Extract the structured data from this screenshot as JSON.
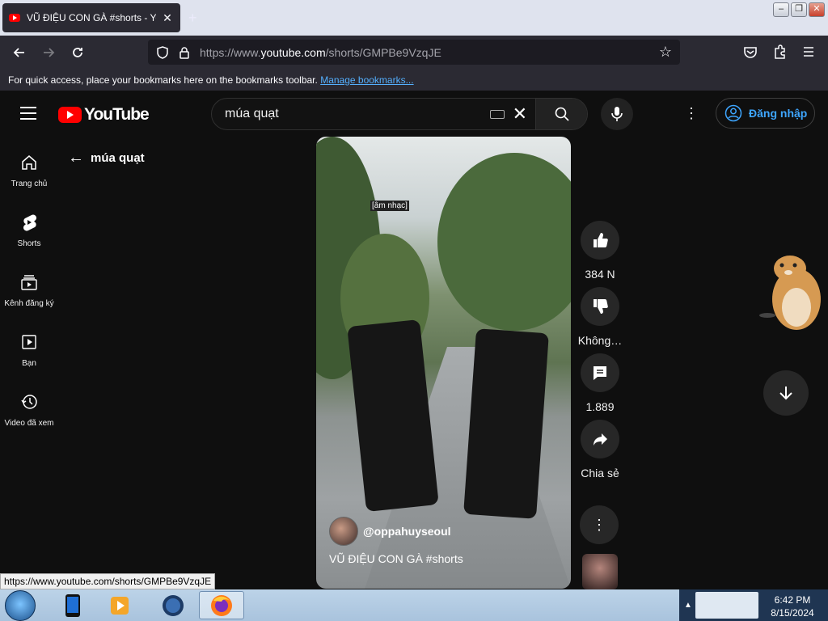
{
  "browser": {
    "tab_title": "VŨ ĐIỆU CON GÀ #shorts - YouTube",
    "tab_close": "✕",
    "new_tab": "+",
    "url_prefix": "https://www.",
    "url_domain": "youtube.com",
    "url_path": "/shorts/GMPBe9VzqJE",
    "bookmarks_text": "For quick access, place your bookmarks here on the bookmarks toolbar.",
    "bookmarks_link": "Manage bookmarks..."
  },
  "youtube": {
    "logo_text": "YouTube",
    "search_value": "múa quạt",
    "signin_label": "Đăng nhập",
    "back_query": "múa quạt"
  },
  "sidebar": {
    "items": [
      {
        "label": "Trang chủ",
        "icon": "home-icon"
      },
      {
        "label": "Shorts",
        "icon": "shorts-icon"
      },
      {
        "label": "Kênh đăng ký",
        "icon": "subscriptions-icon"
      },
      {
        "label": "Bạn",
        "icon": "you-icon"
      },
      {
        "label": "Video đã xem",
        "icon": "history-icon"
      }
    ]
  },
  "video": {
    "overlay_tag": "[âm nhạc]",
    "channel": "@oppahuyseoul",
    "title": "VŨ ĐIỆU CON GÀ #shorts"
  },
  "actions": {
    "like_count": "384 N",
    "dislike_label": "Không…",
    "comment_count": "1.889",
    "share_label": "Chia sẻ"
  },
  "status_url": "https://www.youtube.com/shorts/GMPBe9VzqJE",
  "taskbar": {
    "time": "6:42 PM",
    "date": "8/15/2024"
  },
  "colors": {
    "yt_red": "#ff0000",
    "link_blue": "#3ea6ff",
    "background": "#0f0f0f"
  }
}
